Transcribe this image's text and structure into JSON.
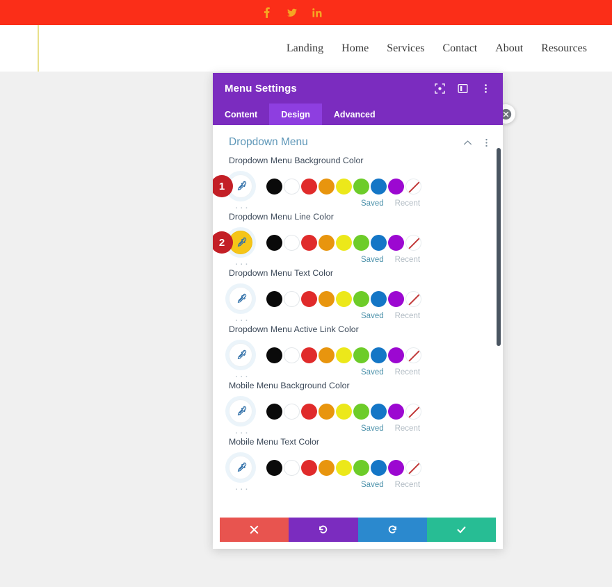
{
  "site": {
    "topbar": {
      "background": "#fb2e18",
      "icon_color": "#f5a623",
      "social": [
        {
          "name": "facebook-icon",
          "label": "Facebook"
        },
        {
          "name": "twitter-icon",
          "label": "Twitter"
        },
        {
          "name": "linkedin-icon",
          "label": "LinkedIn"
        }
      ]
    },
    "nav": {
      "items": [
        {
          "label": "Landing"
        },
        {
          "label": "Home"
        },
        {
          "label": "Services"
        },
        {
          "label": "Contact"
        },
        {
          "label": "About"
        },
        {
          "label": "Resources"
        }
      ]
    },
    "accent_rule_color": "#e8e08a"
  },
  "close_button": {
    "label": "Close",
    "icon": "close-icon"
  },
  "modal": {
    "title": "Menu Settings",
    "header_icons": [
      {
        "name": "focus-icon",
        "label": "Focus"
      },
      {
        "name": "layout-icon",
        "label": "Layout"
      },
      {
        "name": "more-vertical-icon",
        "label": "More options"
      }
    ],
    "tabs": [
      {
        "label": "Content",
        "active": false
      },
      {
        "label": "Design",
        "active": true
      },
      {
        "label": "Advanced",
        "active": false
      }
    ],
    "section": {
      "title": "Dropdown Menu",
      "collapse_icon": "chevron-up-icon",
      "more_icon": "more-vertical-icon"
    },
    "palette": [
      {
        "name": "black",
        "hex": "#0a0a0a",
        "ring": false
      },
      {
        "name": "white",
        "hex": "#ffffff",
        "ring": true
      },
      {
        "name": "red",
        "hex": "#e02b2b",
        "ring": false
      },
      {
        "name": "orange",
        "hex": "#e8950e",
        "ring": false
      },
      {
        "name": "yellow",
        "hex": "#ece81a",
        "ring": false
      },
      {
        "name": "green",
        "hex": "#6dcc29",
        "ring": false
      },
      {
        "name": "blue",
        "hex": "#1476c6",
        "ring": false
      },
      {
        "name": "purple",
        "hex": "#9c08d1",
        "ring": false
      },
      {
        "name": "none",
        "hex": "transparent",
        "ring": false
      }
    ],
    "links": {
      "saved": "Saved",
      "recent": "Recent",
      "more": "..."
    },
    "fields": [
      {
        "label": "Dropdown Menu Background Color",
        "badge": "1",
        "picker_filled": false,
        "picker_color": "#ffffff"
      },
      {
        "label": "Dropdown Menu Line Color",
        "badge": "2",
        "picker_filled": true,
        "picker_color": "#f5c518"
      },
      {
        "label": "Dropdown Menu Text Color",
        "badge": "",
        "picker_filled": false,
        "picker_color": "#ffffff"
      },
      {
        "label": "Dropdown Menu Active Link Color",
        "badge": "",
        "picker_filled": false,
        "picker_color": "#ffffff"
      },
      {
        "label": "Mobile Menu Background Color",
        "badge": "",
        "picker_filled": false,
        "picker_color": "#ffffff"
      },
      {
        "label": "Mobile Menu Text Color",
        "badge": "",
        "picker_filled": false,
        "picker_color": "#ffffff"
      }
    ],
    "footer": [
      {
        "name": "cancel-button",
        "icon": "close-icon",
        "class": "cancel",
        "label": "Cancel"
      },
      {
        "name": "undo-button",
        "icon": "undo-icon",
        "class": "undo",
        "label": "Undo"
      },
      {
        "name": "redo-button",
        "icon": "redo-icon",
        "class": "redo",
        "label": "Redo"
      },
      {
        "name": "save-button",
        "icon": "check-icon",
        "class": "save",
        "label": "Save"
      }
    ]
  }
}
